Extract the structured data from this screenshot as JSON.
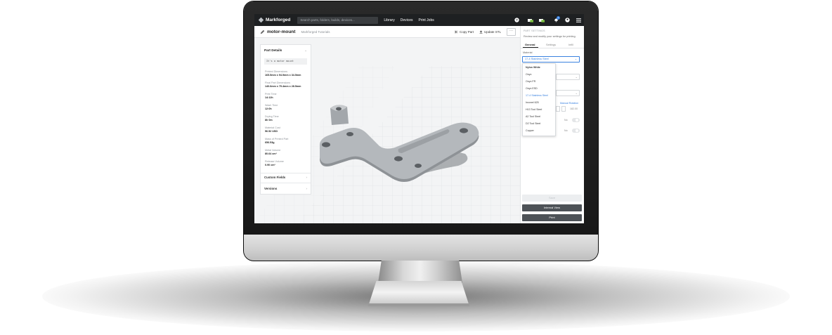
{
  "app": {
    "brand": "Markforged",
    "search_placeholder": "Search parts, folders, builds, devices...",
    "nav": [
      "Library",
      "Devices",
      "Print Jobs"
    ],
    "notification_count": "1"
  },
  "part": {
    "title": "motor-mount",
    "folder": "Markforged Tutorials",
    "copy_label": "Copy Part",
    "update_label": "Update STL",
    "more_label": "···"
  },
  "details": {
    "heading": "Part Details",
    "description": "It's a motor mount",
    "props": [
      {
        "label": "Printed Dimensions",
        "value": "165.5mm x 94.9mm x 34.5mm"
      },
      {
        "label": "Final Part Dimensions",
        "value": "140.6mm x 79.4mm x 28.5mm"
      },
      {
        "label": "Print Time",
        "value": "14:12h"
      },
      {
        "label": "Wash Time",
        "value": "12:0h"
      },
      {
        "label": "Drying Time",
        "value": "8h 0m"
      },
      {
        "label": "Material Cost",
        "value": "56.52 USD"
      },
      {
        "label": "Mass of Printed Part",
        "value": "656.53g"
      },
      {
        "label": "Metal Volume",
        "value": "80.64 cm³"
      },
      {
        "label": "Release Volume",
        "value": "0.90 cm³"
      }
    ],
    "sections": [
      "Custom Fields",
      "Versions"
    ]
  },
  "settings": {
    "title": "PART SETTINGS",
    "description": "Review and modify your settings for printing.",
    "tabs": [
      "General",
      "Settings",
      "Infill"
    ],
    "material_label": "Material",
    "material_value": "17-4 Stainless Steel",
    "options": [
      "Nylon White",
      "Onyx",
      "Onyx FR",
      "Onyx ESD",
      "17-4 Stainless Steel",
      "Inconel 625",
      "H13 Tool Steel",
      "A2 Tool Steel",
      "D2 Tool Steel",
      "Copper"
    ],
    "manual_rotation": "Manual Rotation",
    "rotation_value": "182.00",
    "toggle_label_1": "No",
    "toggle_label_2": "No",
    "buttons": {
      "save": "Save",
      "internal": "Internal View",
      "print": "Print"
    }
  },
  "colors": {
    "accent": "#3a82e0",
    "topbar": "#1e2022",
    "button": "#4d5257"
  }
}
